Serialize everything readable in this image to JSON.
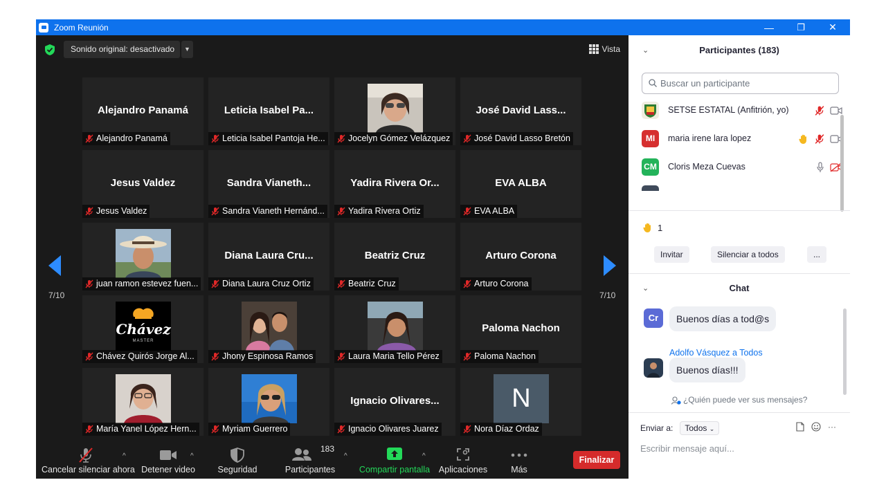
{
  "window": {
    "title": "Zoom Reunión",
    "minimize": "—",
    "restore": "❐",
    "close": "✕"
  },
  "meeting": {
    "audio_button": "Sonido original: desactivado",
    "audio_caret": "▼",
    "view_label": "Vista",
    "page_left": "7/10",
    "page_right": "7/10"
  },
  "tiles": [
    {
      "big": "Alejandro Panamá",
      "label": "Alejandro Panamá"
    },
    {
      "big": "Leticia Isabel Pa...",
      "label": "Leticia Isabel Pantoja He..."
    },
    {
      "big": "",
      "label": "Jocelyn Gómez Velázquez"
    },
    {
      "big": "José David Lass...",
      "label": "José David Lasso Bretón"
    },
    {
      "big": "Jesus Valdez",
      "label": "Jesus Valdez"
    },
    {
      "big": "Sandra Vianeth...",
      "label": "Sandra Vianeth Hernánd..."
    },
    {
      "big": "Yadira Rivera Or...",
      "label": "Yadira Rivera Ortiz"
    },
    {
      "big": "EVA ALBA",
      "label": "EVA ALBA"
    },
    {
      "big": "",
      "label": "juan ramon estevez fuen..."
    },
    {
      "big": "Diana Laura Cru...",
      "label": "Diana Laura Cruz Ortiz"
    },
    {
      "big": "Beatriz Cruz",
      "label": "Beatriz Cruz"
    },
    {
      "big": "Arturo Corona",
      "label": "Arturo Corona"
    },
    {
      "big": "",
      "label": "Chávez Quirós Jorge Al..."
    },
    {
      "big": "",
      "label": "Jhony Espinosa Ramos"
    },
    {
      "big": "",
      "label": "Laura Maria Tello Pérez"
    },
    {
      "big": "Paloma Nachon",
      "label": "Paloma Nachon"
    },
    {
      "big": "",
      "label": "María Yanel López Hern..."
    },
    {
      "big": "",
      "label": "Myriam Guerrero"
    },
    {
      "big": "Ignacio Olivares...",
      "label": "Ignacio Olivares Juarez"
    },
    {
      "big": "",
      "label": "Nora Díaz Ordaz"
    }
  ],
  "logo_text": "Chávez",
  "logo_sub": "MASTER",
  "nora_initial": "N",
  "toolbar": {
    "unmute": "Cancelar silenciar ahora",
    "stop_video": "Detener video",
    "security": "Seguridad",
    "participants": "Participantes",
    "participants_count": "183",
    "share": "Compartir pantalla",
    "apps": "Aplicaciones",
    "more": "Más",
    "end": "Finalizar",
    "caret": "^"
  },
  "participants_panel": {
    "title": "Participantes (183)",
    "chevron": "⌄",
    "search_placeholder": "Buscar un participante",
    "rows": [
      {
        "initials": "",
        "name": "SETSE ESTATAL (Anfitrión, yo)"
      },
      {
        "initials": "MI",
        "name": "maria irene lara lopez"
      },
      {
        "initials": "CM",
        "name": "Cloris Meza Cuevas"
      }
    ],
    "raise_count": "1",
    "invite": "Invitar",
    "mute_all": "Silenciar a todos",
    "more": "..."
  },
  "chat_panel": {
    "title": "Chat",
    "chevron": "⌄",
    "msg1_avatar": "Cr",
    "msg1": "Buenos días a tod@s",
    "msg2_sender": "Adolfo Vásquez a Todos",
    "msg2": "Buenos días!!!",
    "who_sees": "¿Quién puede ver sus mensajes?",
    "send_to_label": "Enviar a:",
    "send_to_value": "Todos",
    "compose_placeholder": "Escribir mensaje aquí...",
    "more": "···"
  },
  "colors": {
    "accent": "#0e72ed",
    "end_red": "#d52b2b",
    "share_green": "#23d959",
    "mic_off_red": "#e02828"
  }
}
